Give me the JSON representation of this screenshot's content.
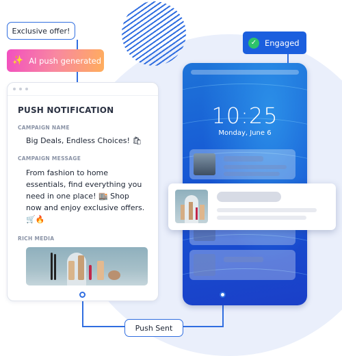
{
  "flow": {
    "exclusive_offer": "Exclusive offer!",
    "ai_push_label": "AI push generated",
    "ai_icon": "magic-wand-icon",
    "push_sent": "Push Sent",
    "engaged": "Engaged",
    "engaged_icon": "check-circle-icon"
  },
  "card": {
    "title": "PUSH NOTIFICATION",
    "campaign_name_label": "CAMPAIGN NAME",
    "campaign_name": "Big Deals, Endless Choices! 🛍",
    "campaign_message_label": "CAMPAIGN MESSAGE",
    "campaign_message": "From fashion to home essentials, find everything you need in one place! 🏬 Shop now and enjoy exclusive offers. 🛒🔥",
    "rich_media_label": "RICH MEDIA"
  },
  "phone": {
    "time": "10:25",
    "date": "Monday, June 6"
  },
  "colors": {
    "accent": "#2f6de0",
    "engaged_bg": "#1b5fde",
    "check": "#2dc26b",
    "ai_gradient_start": "#f24fc0",
    "ai_gradient_end": "#ffae5c"
  }
}
